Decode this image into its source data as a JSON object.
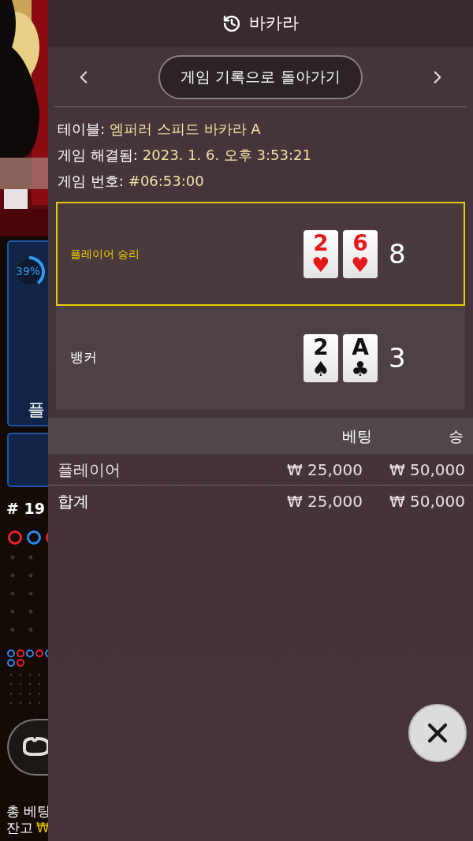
{
  "background": {
    "progress_label": "39%",
    "side_label": "플",
    "round": "# 19",
    "road": [
      {
        "color": "#e8232a"
      },
      {
        "color": "#2f86f0"
      },
      {
        "color": "#e8232a"
      }
    ],
    "road_small": [
      {
        "color": "#2f86f0"
      },
      {
        "color": "#e8232a"
      },
      {
        "color": "#2f86f0"
      },
      {
        "color": "#e8232a"
      },
      {
        "color": "#2f86f0"
      },
      {
        "color": "#2f86f0"
      },
      {
        "color": "#e8232a"
      }
    ],
    "total_bet_label": "총 베팅",
    "balance_label": "잔고",
    "balance_currency": "₩"
  },
  "header": {
    "title": "바카라"
  },
  "nav": {
    "back_button": "게임 기록으로 돌아가기"
  },
  "details": [
    {
      "label": "테이블:",
      "value": "엠퍼러 스피드 바카라 A"
    },
    {
      "label": "게임 해결됨:",
      "value": "2023. 1. 6. 오후 3:53:21"
    },
    {
      "label": "게임 번호:",
      "value": "#06:53:00"
    }
  ],
  "hands": [
    {
      "name": "플레이어 승리",
      "selected": true,
      "score": "8",
      "cards": [
        {
          "rank": "2",
          "suit": "♥",
          "color": "#e3191c"
        },
        {
          "rank": "6",
          "suit": "♥",
          "color": "#e3191c"
        }
      ]
    },
    {
      "name": "뱅커",
      "selected": false,
      "score": "3",
      "cards": [
        {
          "rank": "2",
          "suit": "♠",
          "color": "#111111"
        },
        {
          "rank": "A",
          "suit": "♣",
          "color": "#111111"
        }
      ]
    }
  ],
  "bets": {
    "columns": [
      "베팅",
      "승"
    ],
    "rows": [
      {
        "kind": "item",
        "label": "플레이어",
        "bet": "₩ 25,000",
        "win": "₩ 50,000"
      },
      {
        "kind": "total",
        "label": "합계",
        "bet": "₩ 25,000",
        "win": "₩ 50,000"
      }
    ]
  }
}
